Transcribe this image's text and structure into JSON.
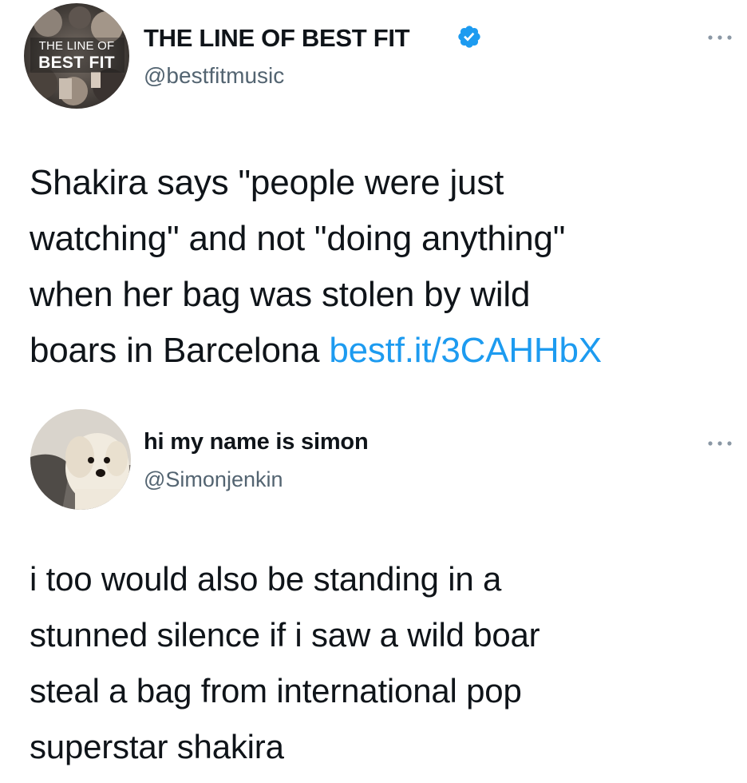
{
  "tweets": [
    {
      "avatar": {
        "logo_line1": "THE LINE OF",
        "logo_line2": "BEST FIT"
      },
      "name": "THE LINE OF BEST FIT",
      "verified": true,
      "handle": "@bestfitmusic",
      "text": "Shakira says \"people were just\nwatching\" and not \"doing anything\"\nwhen her bag was stolen by wild\nboars in Barcelona ",
      "link": "bestf.it/3CAHHbX",
      "more_icon": "more-horizontal-icon"
    },
    {
      "avatar": {
        "description_icon": "dog-avatar"
      },
      "name": "hi my name is simon",
      "verified": false,
      "handle": "@Simonjenkin",
      "text": "i too would also be standing in a\nstunned silence if i saw a wild boar\nsteal a bag from international pop\nsuperstar shakira",
      "more_icon": "more-horizontal-icon"
    }
  ],
  "colors": {
    "text": "#0f1419",
    "handle": "#536471",
    "link": "#1d9bf0",
    "verified": "#1d9bf0"
  }
}
